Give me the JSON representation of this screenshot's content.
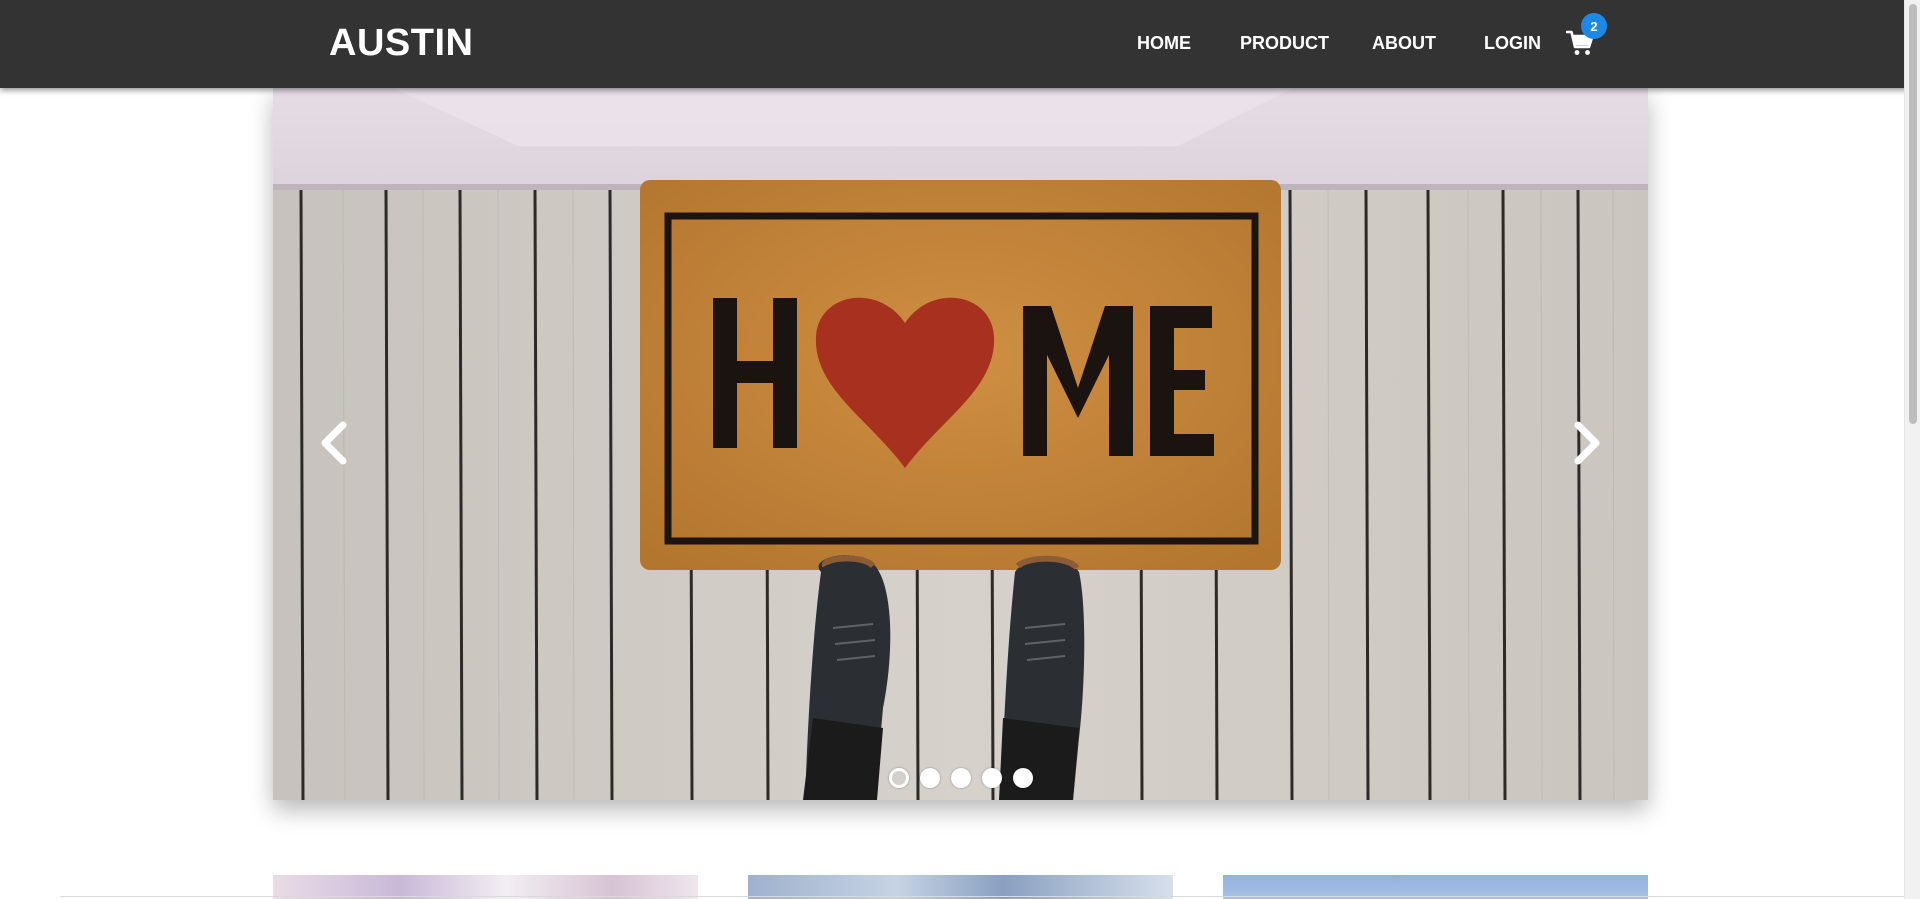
{
  "header": {
    "brand": "AUSTIN",
    "nav": [
      {
        "label": "HOME"
      },
      {
        "label": "PRODUCT"
      },
      {
        "label": "ABOUT"
      },
      {
        "label": "LOGIN"
      }
    ],
    "cart": {
      "icon": "cart-icon",
      "count": "2",
      "badge_color": "#1e88e5"
    },
    "background_color": "#333333"
  },
  "hero": {
    "slide_count": 5,
    "active_slide": 1,
    "prev_icon": "chevron-left-icon",
    "next_icon": "chevron-right-icon",
    "photo": {
      "mat_text_left": "H",
      "mat_text_right": "ME",
      "heart_color": "#a8301f",
      "mat_color": "#c7863a"
    }
  },
  "products": {
    "thumbnail_count": 3
  }
}
